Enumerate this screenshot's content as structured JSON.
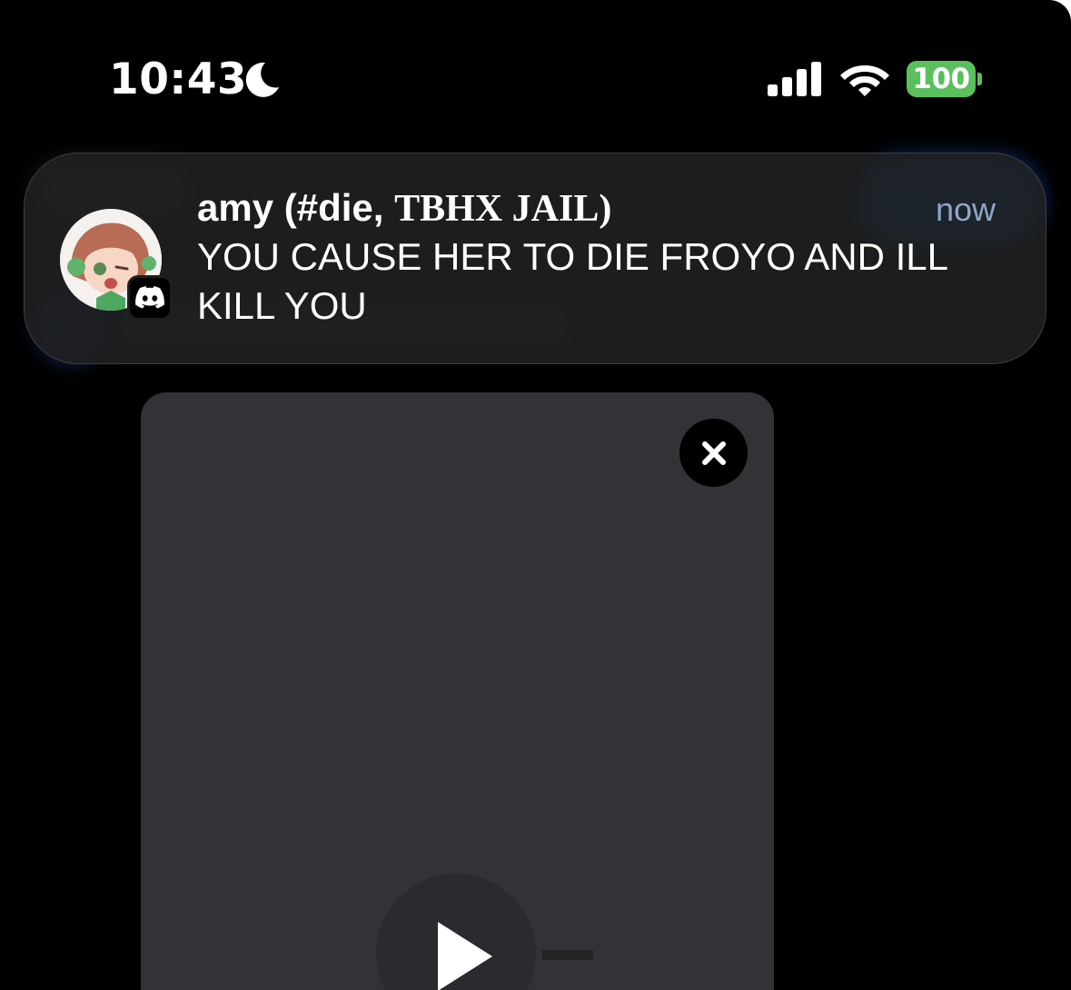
{
  "status_bar": {
    "time": "10:43",
    "battery_level": "100",
    "icons": [
      "moon-icon",
      "signal-icon",
      "wifi-icon",
      "battery-icon"
    ],
    "battery_color": "#5ac05c"
  },
  "notification": {
    "sender": "amy (#die, ",
    "channel": "TBHX JAIL)",
    "time": "now",
    "message": "YOU CAUSE HER TO DIE FROYO AND ILL KILL YOU",
    "app_icon": "discord-icon",
    "time_color": "#8fa6c8"
  },
  "media": {
    "icons": [
      "close-icon",
      "play-icon"
    ]
  }
}
